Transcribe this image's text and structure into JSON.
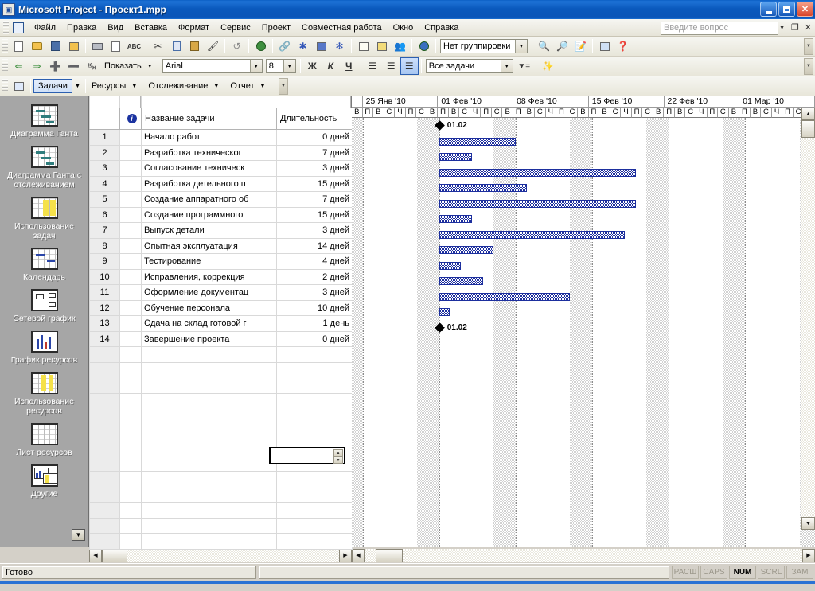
{
  "window": {
    "title": "Microsoft Project - Проект1.mpp",
    "minimize_label": "_",
    "maximize_label": "❐",
    "close_label": "✕"
  },
  "menubar": {
    "items": [
      "Файл",
      "Правка",
      "Вид",
      "Вставка",
      "Формат",
      "Сервис",
      "Проект",
      "Совместная работа",
      "Окно",
      "Справка"
    ],
    "ask_placeholder": "Введите вопрос",
    "restore_label": "❐",
    "close_label": "✕"
  },
  "toolbar_standard": {
    "group_label": "Нет группировки",
    "icons": [
      "new-document-icon",
      "open-folder-icon",
      "save-icon",
      "search-file-icon",
      "print-icon",
      "print-preview-icon",
      "spelling-icon",
      "cut-icon",
      "copy-icon",
      "paste-icon",
      "format-painter-icon",
      "undo-icon",
      "hyperlink-globe-icon",
      "link-tasks-icon",
      "unlink-tasks-icon",
      "split-task-icon",
      "task-information-icon",
      "notes-icon",
      "assign-resources-icon",
      "publish-icon",
      "zoom-in-icon",
      "zoom-out-icon",
      "goto-task-icon",
      "copy-picture-icon",
      "help-icon"
    ]
  },
  "toolbar_formatting": {
    "show_label": "Показать",
    "font_name": "Arial",
    "font_size": "8",
    "bold_label": "Ж",
    "italic_label": "К",
    "underline_label": "Ч",
    "filter_label": "Все задачи",
    "align_left_icon": "align-left-icon",
    "align_center_icon": "align-center-icon",
    "align_right_icon": "align-right-icon"
  },
  "toolbar_guide": {
    "toggle_icon": "project-guide-icon",
    "buttons": [
      "Задачи",
      "Ресурсы",
      "Отслеживание",
      "Отчет"
    ],
    "selected": "Задачи"
  },
  "viewbar": {
    "items": [
      {
        "label": "Диаграмма Ганта",
        "icon": "gantt-chart-icon"
      },
      {
        "label": "Диаграмма Ганта с отслеживанием",
        "icon": "tracking-gantt-icon"
      },
      {
        "label": "Использование задач",
        "icon": "task-usage-icon"
      },
      {
        "label": "Календарь",
        "icon": "calendar-icon"
      },
      {
        "label": "Сетевой график",
        "icon": "network-diagram-icon"
      },
      {
        "label": "График ресурсов",
        "icon": "resource-graph-icon"
      },
      {
        "label": "Использование ресурсов",
        "icon": "resource-usage-icon"
      },
      {
        "label": "Лист ресурсов",
        "icon": "resource-sheet-icon"
      },
      {
        "label": "Другие",
        "icon": "more-views-icon"
      }
    ],
    "more_arrow_icon": "chevron-down-icon"
  },
  "table": {
    "columns": [
      "",
      "info-icon",
      "Название задачи",
      "Длительность"
    ],
    "rows": [
      {
        "num": "1",
        "name": "Начало работ",
        "duration": "0 дней"
      },
      {
        "num": "2",
        "name": "Разработка техническог",
        "duration": "7 дней"
      },
      {
        "num": "3",
        "name": "Согласование техническ",
        "duration": "3 дней"
      },
      {
        "num": "4",
        "name": "Разработка детельного п",
        "duration": "15 дней"
      },
      {
        "num": "5",
        "name": "Создание аппаратного об",
        "duration": "7 дней"
      },
      {
        "num": "6",
        "name": "Создание программного",
        "duration": "15 дней"
      },
      {
        "num": "7",
        "name": "Выпуск детали",
        "duration": "3 дней"
      },
      {
        "num": "8",
        "name": "Опытная эксплуатация",
        "duration": "14 дней"
      },
      {
        "num": "9",
        "name": "Тестирование",
        "duration": "4 дней"
      },
      {
        "num": "10",
        "name": "Исправления, коррекция",
        "duration": "2 дней"
      },
      {
        "num": "11",
        "name": "Оформление документац",
        "duration": "3 дней"
      },
      {
        "num": "12",
        "name": "Обучение персонала",
        "duration": "10 дней"
      },
      {
        "num": "13",
        "name": "Сдача на склад готовой г",
        "duration": "1 день"
      },
      {
        "num": "14",
        "name": "Завершение проекта",
        "duration": "0 дней"
      }
    ],
    "blank_row_count": 13,
    "selected_cell_value": ""
  },
  "chart_data": {
    "type": "bar",
    "title": "Диаграмма Ганта",
    "timescale_weeks": [
      "25 Янв '10",
      "01 Фев '10",
      "08 Фев '10",
      "15 Фев '10",
      "22 Фев '10",
      "01 Мар '10"
    ],
    "day_letters": [
      "П",
      "В",
      "С",
      "Ч",
      "П",
      "С",
      "В"
    ],
    "leading_day_letter": "В",
    "bar_color": "#1d2f9e",
    "milestone_color": "#000000",
    "tasks": [
      {
        "row": 1,
        "name": "Начало работ",
        "type": "milestone",
        "start_day": 0,
        "duration_days": 0,
        "label": "01.02"
      },
      {
        "row": 2,
        "name": "Разработка техническог",
        "type": "bar",
        "start_day": 0,
        "duration_days": 7,
        "label": ""
      },
      {
        "row": 3,
        "name": "Согласование техническ",
        "type": "bar",
        "start_day": 0,
        "duration_days": 3,
        "label": ""
      },
      {
        "row": 4,
        "name": "Разработка детельного п",
        "type": "bar",
        "start_day": 0,
        "duration_days": 18,
        "label": ""
      },
      {
        "row": 5,
        "name": "Создание аппаратного об",
        "type": "bar",
        "start_day": 0,
        "duration_days": 8,
        "label": ""
      },
      {
        "row": 6,
        "name": "Создание программного",
        "type": "bar",
        "start_day": 0,
        "duration_days": 18,
        "label": ""
      },
      {
        "row": 7,
        "name": "Выпуск детали",
        "type": "bar",
        "start_day": 0,
        "duration_days": 3,
        "label": ""
      },
      {
        "row": 8,
        "name": "Опытная эксплуатация",
        "type": "bar",
        "start_day": 0,
        "duration_days": 17,
        "label": ""
      },
      {
        "row": 9,
        "name": "Тестирование",
        "type": "bar",
        "start_day": 0,
        "duration_days": 5,
        "label": ""
      },
      {
        "row": 10,
        "name": "Исправления, коррекция",
        "type": "bar",
        "start_day": 0,
        "duration_days": 2,
        "label": ""
      },
      {
        "row": 11,
        "name": "Оформление документац",
        "type": "bar",
        "start_day": 0,
        "duration_days": 4,
        "label": ""
      },
      {
        "row": 12,
        "name": "Обучение персонала",
        "type": "bar",
        "start_day": 0,
        "duration_days": 12,
        "label": ""
      },
      {
        "row": 13,
        "name": "Сдача на склад готовой г",
        "type": "bar",
        "start_day": 0,
        "duration_days": 1,
        "label": ""
      },
      {
        "row": 14,
        "name": "Завершение проекта",
        "type": "milestone",
        "start_day": 0,
        "duration_days": 0,
        "label": "01.02"
      }
    ],
    "xlabel": "",
    "ylabel": "",
    "grid": true,
    "legend": "none"
  },
  "statusbar": {
    "message": "Готово",
    "indicators": [
      {
        "label": "РАСШ",
        "active": false
      },
      {
        "label": "CAPS",
        "active": false
      },
      {
        "label": "NUM",
        "active": true
      },
      {
        "label": "SCRL",
        "active": false
      },
      {
        "label": "ЗАМ",
        "active": false
      }
    ]
  }
}
